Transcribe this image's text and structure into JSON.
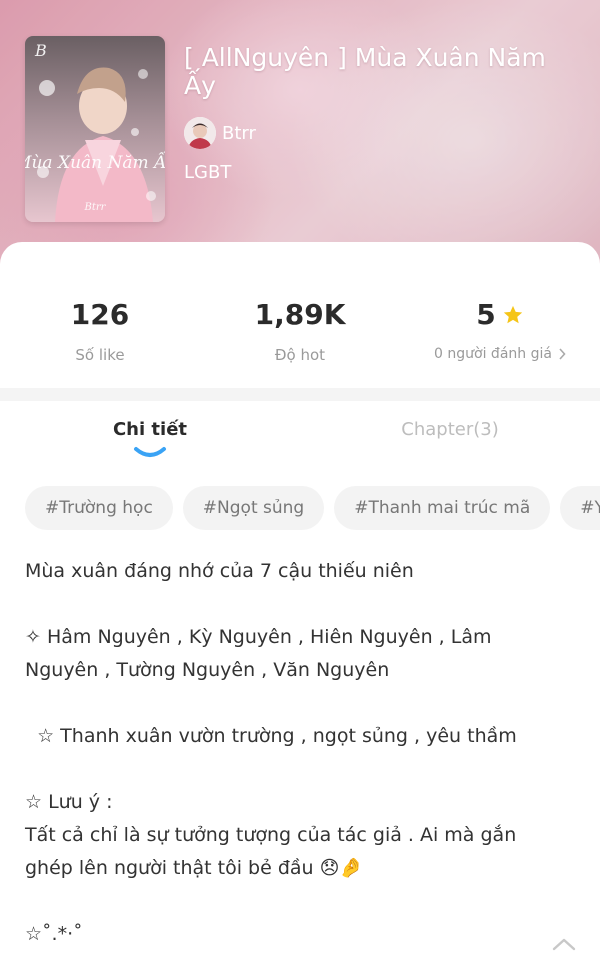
{
  "story": {
    "title": "[ AllNguyên ] Mùa Xuân Năm Ấy",
    "author": "Btrr",
    "genre": "LGBT",
    "cover_text": {
      "title": "Mùa Xuân Năm Ấy",
      "signature": "Btrr"
    }
  },
  "stats": {
    "likes": {
      "value": "126",
      "label": "Số like"
    },
    "hot": {
      "value": "1,89K",
      "label": "Độ hot"
    },
    "rating": {
      "value": "5",
      "label": "0 người đánh giá",
      "star_color": "#f5c518"
    }
  },
  "tabs": [
    {
      "label": "Chi tiết",
      "active": true
    },
    {
      "label": "Chapter(3)",
      "active": false
    }
  ],
  "tags": [
    "#Trường học",
    "#Ngọt sủng",
    "#Thanh mai trúc mã",
    "#Yêu"
  ],
  "description": [
    "Mùa xuân đáng nhớ của 7 cậu thiếu niên",
    "",
    "✧ Hâm Nguyên , Kỳ Nguyên , Hiên Nguyên , Lâm Nguyên , Tường Nguyên , Văn Nguyên",
    "",
    "  ☆ Thanh xuân vườn trường , ngọt sủng , yêu thầm",
    "",
    "☆ Lưu ý :",
    "Tất cả chỉ là sự tưởng tượng của tác giả . Ai mà gắn ghép lên người thật tôi bẻ đầu 😞🤌",
    "",
    "☆˚.*·˚"
  ],
  "colors": {
    "accent": "#3aa3f5",
    "star": "#f5c518",
    "text_primary": "#2b2b2b",
    "text_muted": "#9a9a9a"
  },
  "icons": {
    "rating": "star-icon",
    "rating_more": "chevron-right-icon",
    "scroll_top": "chevron-up-icon"
  }
}
